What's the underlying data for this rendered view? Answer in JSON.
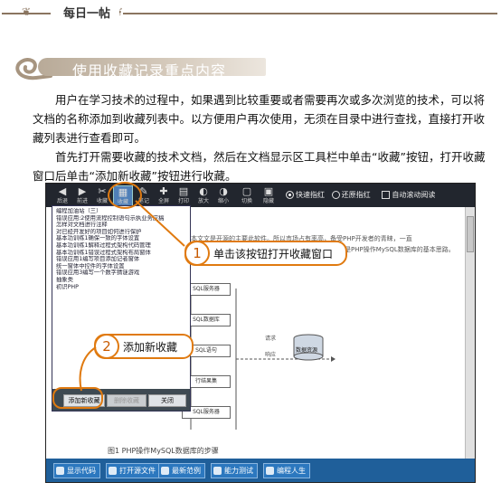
{
  "header": {
    "badge": "每日一帖"
  },
  "section": {
    "title": "使用收藏记录重点内容"
  },
  "paragraphs": [
    "用户在学习技术的过程中，如果遇到比较重要或者需要再次或多次浏览的技术，可以将文档的名称添加到收藏列表中。以方便用户再次使用，无须在目录中进行查找，直接打开收藏列表进行查看即可。",
    "首先打开需要收藏的技术文档，然后在文档显示区工具栏中单击“收藏”按钮，打开收藏窗口后单击“添加新收藏”按钮进行收藏。"
  ],
  "app": {
    "toolbar": {
      "buttons": [
        {
          "glyph": "◀",
          "label": "后退"
        },
        {
          "glyph": "▶",
          "label": "前进"
        },
        {
          "glyph": "✂",
          "label": "收藏"
        },
        {
          "glyph": "▦",
          "label": "收藏"
        },
        {
          "glyph": "✎",
          "label": "笔记"
        },
        {
          "glyph": "✚",
          "label": "全屏"
        },
        {
          "glyph": "▤",
          "label": "打印"
        },
        {
          "glyph": "◐",
          "label": "放大"
        },
        {
          "glyph": "◑",
          "label": "缩小"
        },
        {
          "glyph": "▢",
          "label": "切换"
        },
        {
          "glyph": "▣",
          "label": "隐藏"
        }
      ],
      "mode_options": [
        "快速指红",
        "还原指红"
      ],
      "mode_selected": 0,
      "auto_read": "自动滚动阅读"
    },
    "favorites": {
      "items": [
        "编程加油站（三）",
        "错误应用:2使用流程控制语句示执业务应稿",
        "怎样对文档进行注释",
        "对已经开发好的项目如何进行保护",
        "基本功训练1确保一致的字体设置",
        "基本功训练1解释过程式架构代码管理",
        "基本功训练1错误过程式架构布局窗体",
        "错误应用1编写项目添加记者窗体",
        "统一窗体中控件的字体设置",
        "错误应用3编写一个数字猜谜游戏",
        "抽象类",
        "初识PHP"
      ],
      "add_button": "添加新收藏",
      "delete_button": "删除收藏",
      "close_button": "关闭"
    },
    "document": {
      "line1": "本文文是开源的主要此软件。所以市场占有率高，备受PHP开发者的青睐，一直",
      "line2": "是PHP操作MySQL数据库的基本思路。",
      "boxes": [
        "SQL服务器",
        "SQL数据库",
        "SQL语句",
        "行结果集",
        "SQL服务器"
      ],
      "request": "请求",
      "response": "响应",
      "db_label": "数据资源",
      "caption": "图1  PHP操作MySQL数据库的步骤"
    },
    "bottom_buttons": [
      "显示代码",
      "打开源文件",
      "最新范例",
      "能力测试",
      "编程人生"
    ]
  },
  "callouts": {
    "step1": {
      "number": "1",
      "text": "单击该按钮打开收藏窗口"
    },
    "step2": {
      "number": "2",
      "text": "添加新收藏"
    }
  },
  "colors": {
    "accent": "#e07a10",
    "toolbar": "#22262e",
    "bottom_bar": "#1f5f9a"
  }
}
